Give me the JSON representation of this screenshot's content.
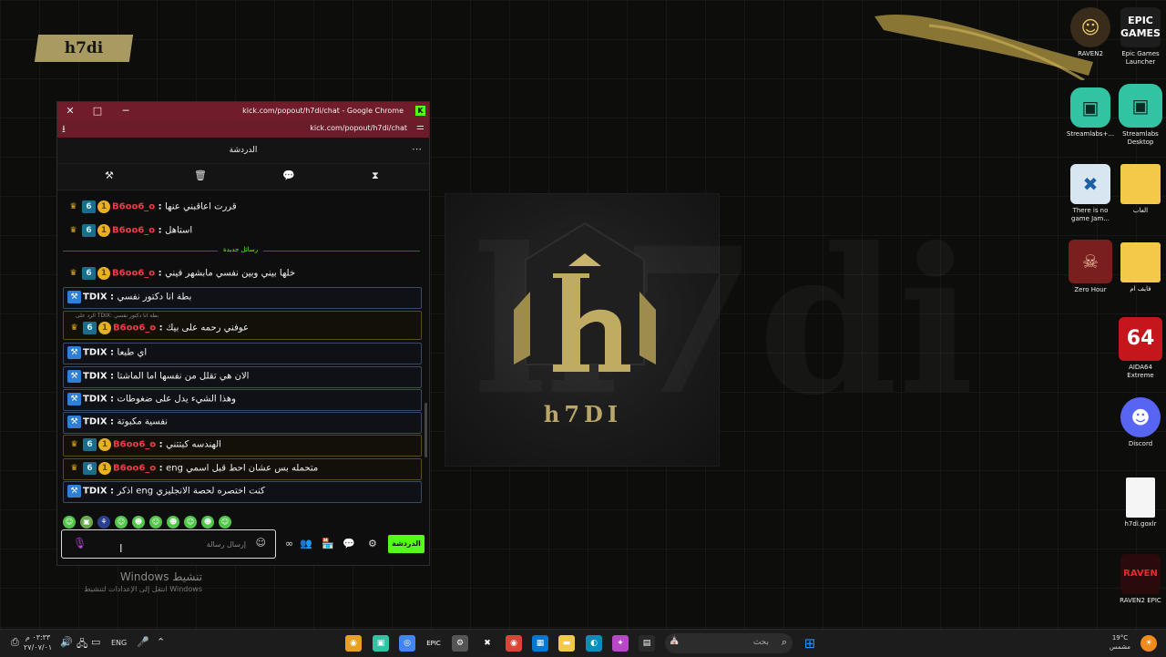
{
  "wallpaper": {
    "corner_logo": "h7di",
    "emblem_text": "h7DI"
  },
  "chat_window": {
    "browser_title": "kick.com/popout/h7di/chat - Google Chrome",
    "url": "kick.com/popout/h7di/chat",
    "chat_header": "الدردشة",
    "new_messages_label": "رسائل جديدة",
    "messages": [
      {
        "user": "B6oo6_o",
        "text": "قررت اعاقبني عنها",
        "mod": false
      },
      {
        "user": "B6oo6_o",
        "text": "استاهل",
        "mod": false
      },
      {
        "user": "B6oo6_o",
        "text": "خلها بيني وبين نفسي مابشهر فيني",
        "mod": false
      },
      {
        "user": "TDIX",
        "text": "بطة انا دكتور نفسي",
        "mod": true
      },
      {
        "user": "B6oo6_o",
        "text": "عوفني رحمه على بيك",
        "mod": true,
        "reply": "الرد على TDIX: بطة انا دكتور نفسي"
      },
      {
        "user": "TDIX",
        "text": "اي طبعا",
        "mod": true
      },
      {
        "user": "TDIX",
        "text": "الان هي تقلل من نفسها اما الماشتا",
        "mod": true
      },
      {
        "user": "TDIX",
        "text": "وهذا الشيء يدل على ضغوطات",
        "mod": true
      },
      {
        "user": "TDIX",
        "text": "نفسية مكبوتة",
        "mod": true
      },
      {
        "user": "B6oo6_o",
        "text": "الهندسه كبتتني",
        "mod": true
      },
      {
        "user": "B6oo6_o",
        "text": "متحمله بس عشان احط قبل اسمي eng",
        "mod": true
      },
      {
        "user": "TDIX",
        "text": "كنت اختصره لحصة الانجليزي eng اذكر",
        "mod": true
      }
    ],
    "input_placeholder": "إرسال رسالة",
    "chat_button": "الدردشة",
    "theme": {
      "accent": "#53fc18",
      "title_bar": "#701c2a"
    }
  },
  "activate_windows": {
    "title": "Windows تنشيط",
    "subtitle": "انتقل إلى الإعدادات لتنشيط Windows"
  },
  "desktop_icons": [
    {
      "label": "RAVEN2",
      "icon": "raven2-icon"
    },
    {
      "label": "Epic Games Launcher",
      "icon": "epic-games-icon"
    },
    {
      "label": "Streamlabs+...",
      "icon": "streamlabs-plus-icon"
    },
    {
      "label": "Streamlabs Desktop",
      "icon": "streamlabs-icon"
    },
    {
      "label": "There is no game Jam...",
      "icon": "game-jam-icon"
    },
    {
      "label": "العاب",
      "icon": "folder-icon"
    },
    {
      "label": "Zero Hour",
      "icon": "zero-hour-icon"
    },
    {
      "label": "فايف ام",
      "icon": "folder-icon"
    },
    {
      "label": "AIDA64 Extreme",
      "icon": "aida64-icon"
    },
    {
      "label": "Discord",
      "icon": "discord-icon"
    },
    {
      "label": "h7di.goxlr",
      "icon": "file-icon"
    },
    {
      "label": "RAVEN2 EPIC",
      "icon": "raven2-epic-icon"
    }
  ],
  "taskbar": {
    "time": "٠٣:٣٣ م",
    "date": "٢٧/٠٧/٠١",
    "language": "ENG",
    "search_placeholder": "بحث",
    "weather_temp": "19°C",
    "weather_text": "مشمس"
  }
}
